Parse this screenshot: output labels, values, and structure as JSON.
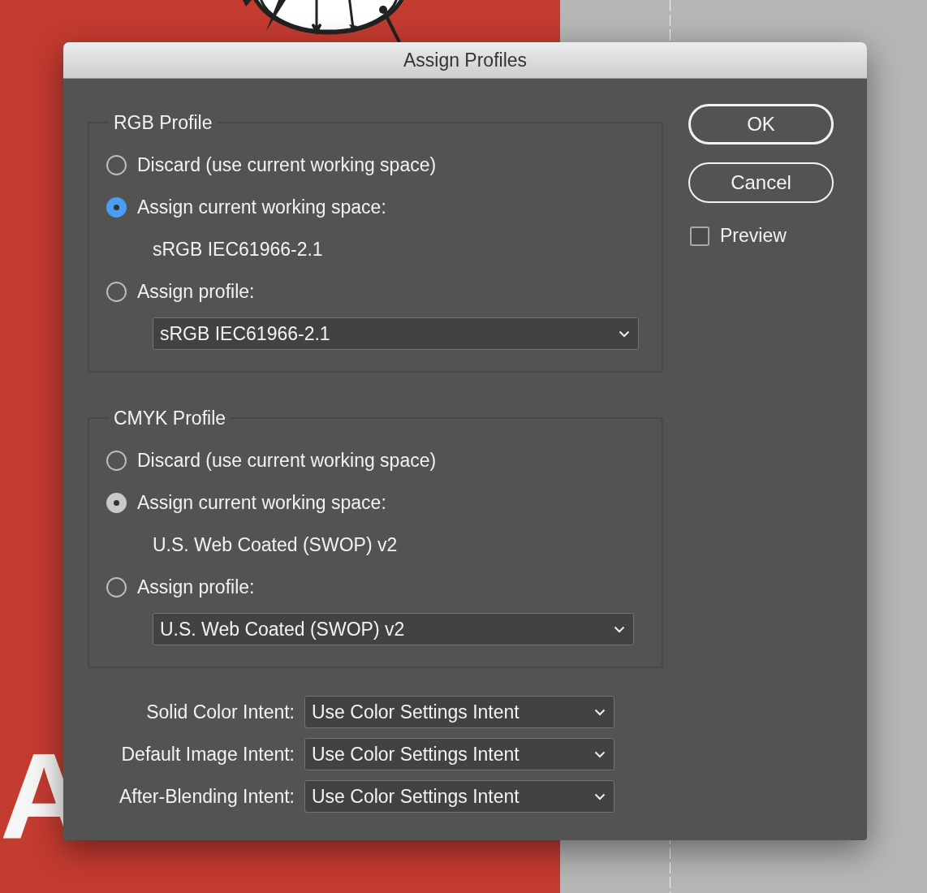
{
  "document": {
    "headline": "A"
  },
  "window": {
    "title": "Assign Profiles"
  },
  "groups": [
    {
      "title": "RGB Profile",
      "options": [
        {
          "kind": "radio",
          "label": "Discard (use current working space)",
          "selected": false
        },
        {
          "kind": "radio",
          "label": "Assign current working space:",
          "selected": true,
          "color": "#4a9df3"
        },
        {
          "kind": "note",
          "label": "sRGB IEC61966-2.1"
        },
        {
          "kind": "radio",
          "label": "Assign profile:",
          "selected": false
        },
        {
          "kind": "select",
          "value": "sRGB IEC61966-2.1"
        }
      ]
    },
    {
      "title": "CMYK Profile",
      "options": [
        {
          "kind": "radio",
          "label": "Discard (use current working space)",
          "selected": false
        },
        {
          "kind": "radio",
          "label": "Assign current working space:",
          "selected": true,
          "color": "#c9c9c9"
        },
        {
          "kind": "note",
          "label": "U.S. Web Coated (SWOP) v2"
        },
        {
          "kind": "radio",
          "label": "Assign profile:",
          "selected": false
        },
        {
          "kind": "select",
          "value": "U.S. Web Coated (SWOP) v2"
        }
      ]
    }
  ],
  "intents": [
    {
      "label": "Solid Color Intent:",
      "value": "Use Color Settings Intent"
    },
    {
      "label": "Default Image Intent:",
      "value": "Use Color Settings Intent"
    },
    {
      "label": "After-Blending Intent:",
      "value": "Use Color Settings Intent"
    }
  ],
  "buttons": [
    {
      "label": "OK",
      "default": true
    },
    {
      "label": "Cancel",
      "default": false
    }
  ],
  "preview": {
    "label": "Preview",
    "checked": false
  }
}
